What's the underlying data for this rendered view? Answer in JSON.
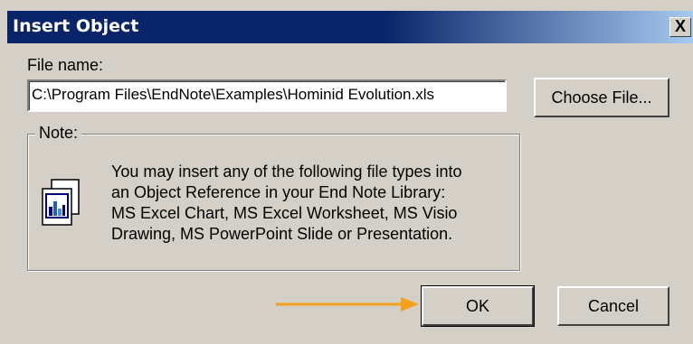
{
  "window": {
    "title": "Insert Object",
    "close_symbol": "X"
  },
  "file": {
    "label": "File name:",
    "value": "C:\\Program Files\\EndNote\\Examples\\Hominid Evolution.xls"
  },
  "buttons": {
    "choose_file": "Choose File...",
    "ok": "OK",
    "cancel": "Cancel"
  },
  "note": {
    "legend": "Note:",
    "lines": [
      "You may insert any of the following file types into",
      "an Object Reference in your End Note Library:",
      "MS Excel Chart, MS Excel Worksheet, MS Visio",
      "Drawing, MS PowerPoint Slide or Presentation."
    ],
    "icon": "chart-document-icon"
  },
  "annotation": {
    "arrow_color": "#f5a11c",
    "arrow_target": "ok-button"
  },
  "colors": {
    "title_bar": "#0a246a",
    "dialog_face": "#d4d0c8"
  }
}
